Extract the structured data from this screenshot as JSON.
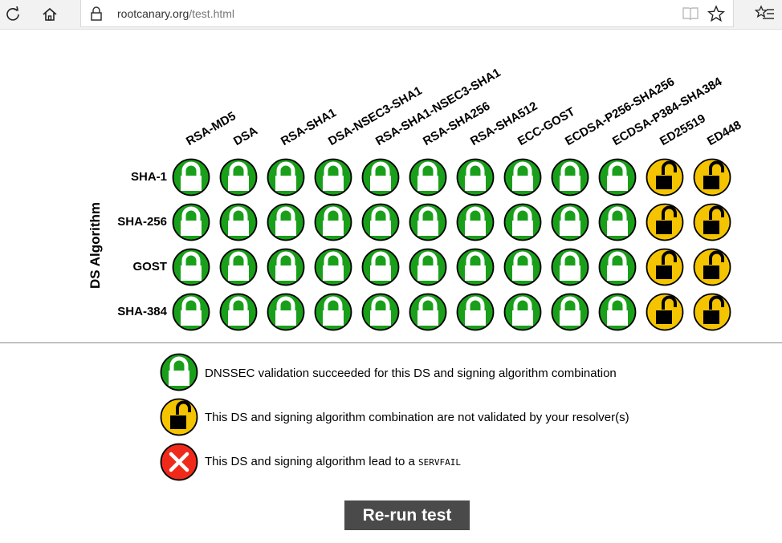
{
  "browser": {
    "url_host": "rootcanary.org",
    "url_path": "/test.html"
  },
  "matrix": {
    "row_axis_title": "DS Algorithm",
    "columns": [
      "RSA-MD5",
      "DSA",
      "RSA-SHA1",
      "DSA-NSEC3-SHA1",
      "RSA-SHA1-NSEC3-SHA1",
      "RSA-SHA256",
      "RSA-SHA512",
      "ECC-GOST",
      "ECDSA-P256-SHA256",
      "ECDSA-P384-SHA384",
      "ED25519",
      "ED448"
    ],
    "rows": [
      {
        "label": "SHA-1",
        "results": [
          "secure",
          "secure",
          "secure",
          "secure",
          "secure",
          "secure",
          "secure",
          "secure",
          "secure",
          "secure",
          "insecure",
          "insecure"
        ]
      },
      {
        "label": "SHA-256",
        "results": [
          "secure",
          "secure",
          "secure",
          "secure",
          "secure",
          "secure",
          "secure",
          "secure",
          "secure",
          "secure",
          "insecure",
          "insecure"
        ]
      },
      {
        "label": "GOST",
        "results": [
          "secure",
          "secure",
          "secure",
          "secure",
          "secure",
          "secure",
          "secure",
          "secure",
          "secure",
          "secure",
          "insecure",
          "insecure"
        ]
      },
      {
        "label": "SHA-384",
        "results": [
          "secure",
          "secure",
          "secure",
          "secure",
          "secure",
          "secure",
          "secure",
          "secure",
          "secure",
          "secure",
          "insecure",
          "insecure"
        ]
      }
    ]
  },
  "legend": {
    "secure": "DNSSEC validation succeeded for this DS and signing algorithm combination",
    "insecure": "This DS and signing algorithm combination are not validated by your resolver(s)",
    "bogus_prefix": "This DS and signing algorithm lead to a ",
    "bogus_code": "SERVFAIL"
  },
  "colors": {
    "secure": "#1a9f1a",
    "insecure": "#f5c400",
    "bogus": "#f02a1a"
  },
  "icons": {
    "secure": "closed-lock-icon",
    "insecure": "open-lock-icon",
    "bogus": "cross-icon"
  },
  "rerun_label": "Re-run test"
}
